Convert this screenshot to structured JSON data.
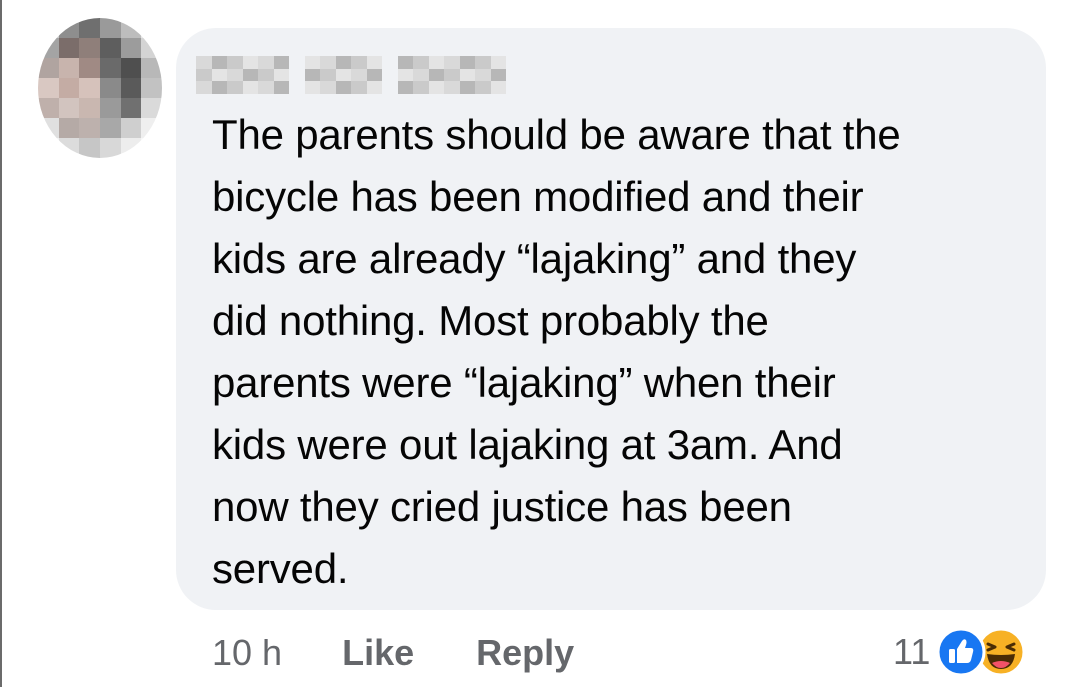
{
  "comment": {
    "author_name": "",
    "text_lines": [
      "The parents should be aware that the",
      "bicycle has been modified and their",
      "kids are already “lajaking” and they",
      "did nothing. Most probably the",
      "parents were “lajaking” when their",
      "kids were out lajaking at 3am. And",
      "now they cried justice has been",
      "served."
    ]
  },
  "actions": {
    "timestamp": "10 h",
    "like_label": "Like",
    "reply_label": "Reply"
  },
  "reactions": {
    "count": "11",
    "icons": [
      "like-icon",
      "haha-icon"
    ],
    "colors": {
      "like": "#1877f2",
      "haha": "#f7b125"
    }
  },
  "colors": {
    "bubble": "#f0f2f5",
    "text": "#050505",
    "secondary_text": "#65676b"
  }
}
